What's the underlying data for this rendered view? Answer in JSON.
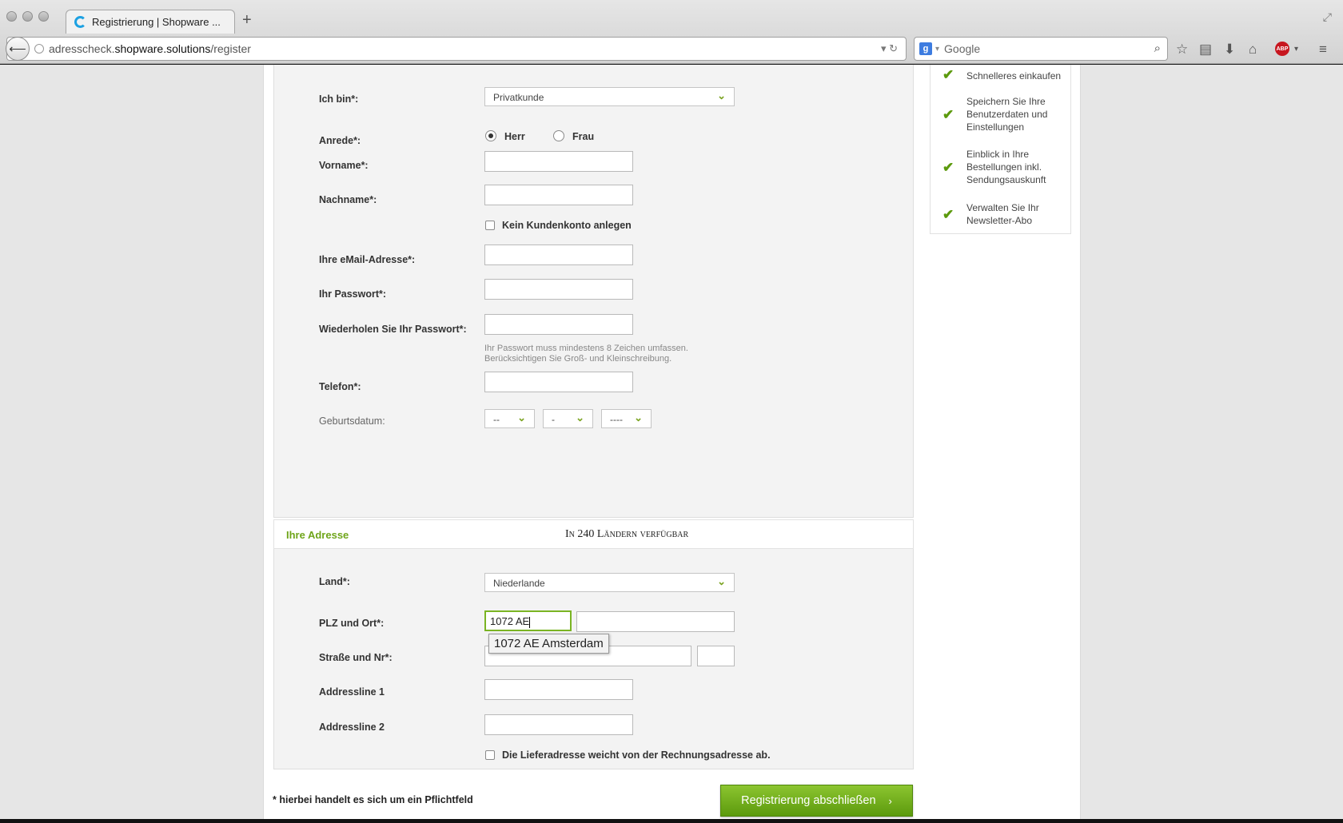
{
  "browser": {
    "tab_title": "Registrierung | Shopware ...",
    "new_tab": "+",
    "url_prefix": "adresscheck.",
    "url_host": "shopware.solutions",
    "url_path": "/register",
    "search_placeholder": "Google",
    "abp_label": "ABP"
  },
  "form": {
    "ich_bin_label": "Ich bin*:",
    "ich_bin_value": "Privatkunde",
    "anrede_label": "Anrede*:",
    "anrede_herr": "Herr",
    "anrede_frau": "Frau",
    "vorname_label": "Vorname*:",
    "nachname_label": "Nachname*:",
    "kein_konto_label": "Kein Kundenkonto anlegen",
    "email_label": "Ihre eMail-Adresse*:",
    "passwort_label": "Ihr Passwort*:",
    "passwort_repeat_label": "Wiederholen Sie Ihr Passwort*:",
    "passwort_hint_1": "Ihr Passwort muss mindestens 8 Zeichen umfassen.",
    "passwort_hint_2": "Berücksichtigen Sie Groß- und Kleinschreibung.",
    "telefon_label": "Telefon*:",
    "geburtsdatum_label": "Geburtsdatum:",
    "geb_day": "--",
    "geb_month": "-",
    "geb_year": "----"
  },
  "address": {
    "section_title": "Ihre Adresse",
    "section_subtitle": "In 240 Ländern verfügbar",
    "land_label": "Land*:",
    "land_value": "Niederlande",
    "plz_label": "PLZ und Ort*:",
    "plz_value": "1072 AE",
    "autocomplete_suggestion": "1072 AE Amsterdam",
    "strasse_label": "Straße und Nr*:",
    "addressline1_label": "Addressline 1",
    "addressline2_label": "Addressline 2",
    "lieferadresse_label": "Die Lieferadresse weicht von der Rechnungsadresse ab."
  },
  "footer": {
    "required_note": "* hierbei handelt es sich um ein Pflichtfeld",
    "submit_label": "Registrierung abschließen",
    "submit_arrow": "›"
  },
  "benefits": [
    "Schnelleres einkaufen",
    "Speichern Sie Ihre Benutzerdaten und Einstellungen",
    "Einblick in Ihre Bestellungen inkl. Sendungsauskunft",
    "Verwalten Sie Ihr Newsletter-Abo"
  ],
  "colors": {
    "accent_green": "#6fa51a",
    "button_green": "#7ab423"
  }
}
